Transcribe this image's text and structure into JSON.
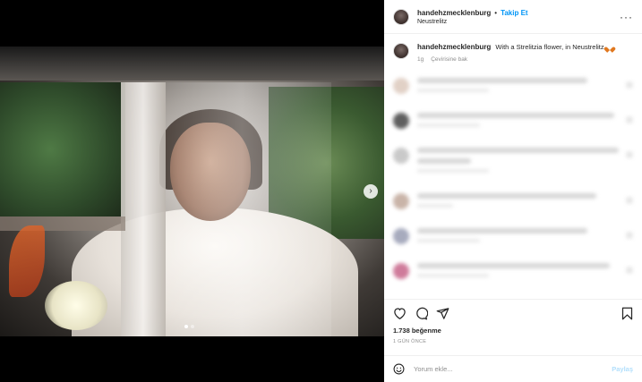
{
  "post": {
    "username": "handehzmecklenburg",
    "bullet": "•",
    "follow_label": "Takip Et",
    "location": "Neustrelitz",
    "more_label": "···"
  },
  "caption": {
    "username": "handehzmecklenburg",
    "text": "With a Strelitzia flower, in Neustrelitz",
    "age": "1g",
    "translate_label": "Çevirisine bak"
  },
  "blurred_comments": [
    {
      "avatar_color": "#d8c2b4"
    },
    {
      "avatar_color": "#2a2a2a"
    },
    {
      "avatar_color": "#b8b8b8"
    },
    {
      "avatar_color": "#b89c8c"
    },
    {
      "avatar_color": "#8a8fa8"
    },
    {
      "avatar_color": "#c0507a"
    }
  ],
  "stats": {
    "likes": "1.738 beğenme",
    "time_ago": "1 GÜN ÖNCE"
  },
  "composer": {
    "placeholder": "Yorum ekle...",
    "post_label": "Paylaş"
  },
  "colors": {
    "accent": "#0095f6",
    "post_disabled": "#b2dffc",
    "muted": "#8e8e8e",
    "text": "#262626"
  },
  "icons": [
    "heart-icon",
    "comment-icon",
    "share-icon",
    "bookmark-icon",
    "emoji-icon",
    "more-icon",
    "chevron-right-icon"
  ]
}
